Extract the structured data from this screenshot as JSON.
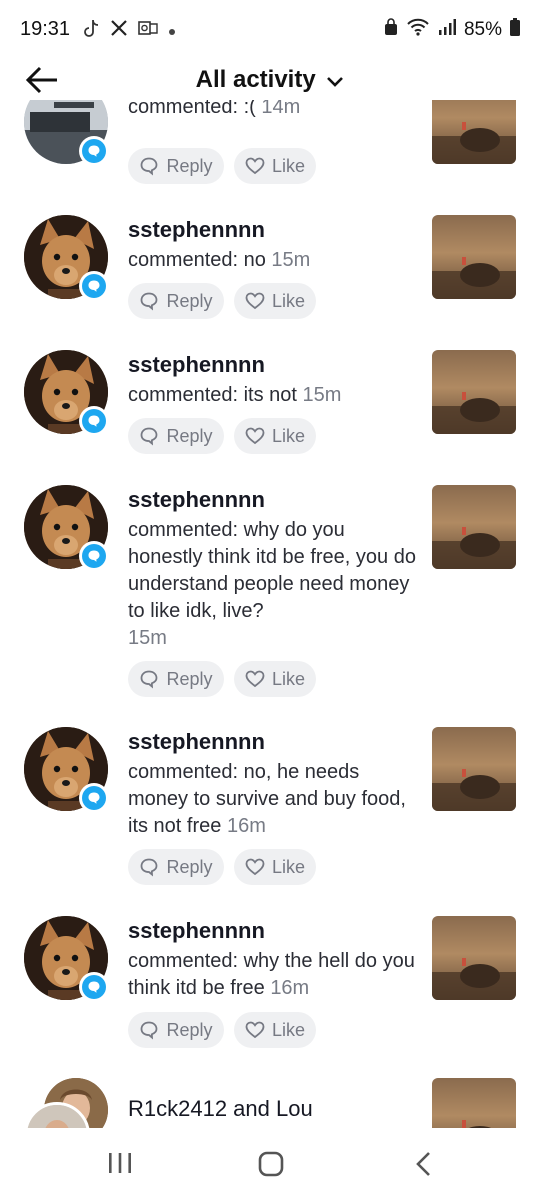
{
  "status": {
    "time": "19:31",
    "battery": "85%"
  },
  "header": {
    "title": "All activity"
  },
  "items": [
    {
      "username": "",
      "prefix": "commented: :(",
      "time": "14m"
    },
    {
      "username": "sstephennnn",
      "prefix": "commented: no",
      "time": "15m"
    },
    {
      "username": "sstephennnn",
      "prefix": "commented: its not",
      "time": "15m"
    },
    {
      "username": "sstephennnn",
      "prefix": "commented: why do you honestly think itd be free, you do understand people need money to like idk, live?",
      "time": "15m"
    },
    {
      "username": "sstephennnn",
      "prefix": "commented: no, he needs money to survive and buy food, its not free",
      "time": "16m"
    },
    {
      "username": "sstephennnn",
      "prefix": "commented: why the hell do you think itd be free",
      "time": "16m"
    },
    {
      "username": "R1ck2412 and Lou",
      "prefix": "",
      "time": ""
    }
  ],
  "actions": {
    "reply": "Reply",
    "like": "Like"
  },
  "icons": {
    "back": "back-arrow-icon",
    "dropdown": "chevron-down-icon",
    "comment_badge": "comment-bubble-icon",
    "reply": "reply-bubble-icon",
    "like": "heart-icon"
  },
  "colors": {
    "badge": "#1ea7f0",
    "button_bg": "#eff0f2"
  }
}
